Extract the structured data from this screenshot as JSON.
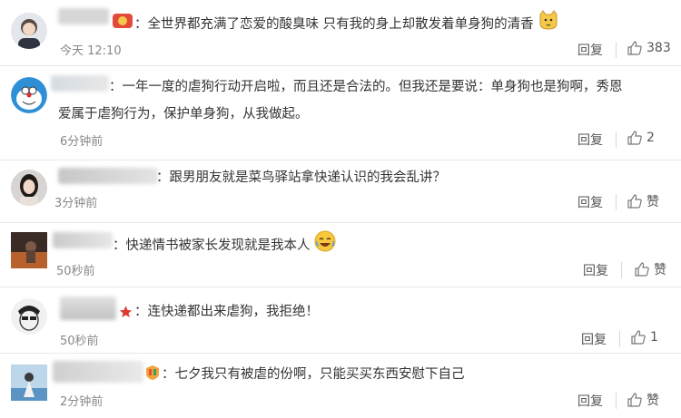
{
  "comments": [
    {
      "text": "：全世界都充满了恋爱的酸臭味 只有我的身上却散发着单身狗的清香",
      "time": "今天 12:10",
      "reply": "回复",
      "likes": "383"
    },
    {
      "text_line1": "：一年一度的虐狗行动开启啦，而且还是合法的。但我还是要说：单身狗也是狗啊，秀恩",
      "text_line2": "爱属于虐狗行为，保护单身狗，从我做起。",
      "time": "6分钟前",
      "reply": "回复",
      "likes": "2"
    },
    {
      "text": "：跟男朋友就是菜鸟驿站拿快递认识的我会乱讲？",
      "time": "3分钟前",
      "reply": "回复",
      "likes": "赞"
    },
    {
      "text": "：快递情书被家长发现就是我本人",
      "time": "50秒前",
      "reply": "回复",
      "likes": "赞"
    },
    {
      "text": "：连快递都出来虐狗，我拒绝！",
      "time": "50秒前",
      "reply": "回复",
      "likes": "1"
    },
    {
      "text": "：七夕我只有被虐的份啊，只能买买东西安慰下自己",
      "time": "2分钟前",
      "reply": "回复",
      "likes": "赞"
    }
  ],
  "colors": {
    "text": "#333333",
    "meta": "#888888",
    "separator": "#e8e8e8",
    "blur_gray": "#c9c9c9",
    "star": "#e0382f"
  }
}
